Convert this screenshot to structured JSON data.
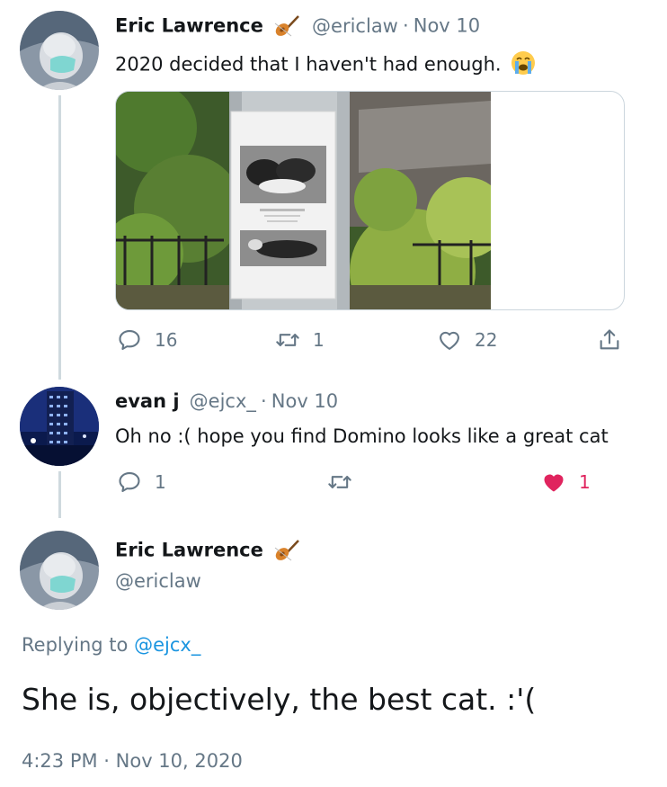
{
  "tweet1": {
    "name": "Eric Lawrence",
    "name_emoji": "violin-emoji",
    "handle": "@ericlaw",
    "sep": "·",
    "date": "Nov 10",
    "text": "2020 decided that I haven't had enough.",
    "text_emoji": "crying-face-emoji",
    "actions": {
      "reply": "16",
      "retweet": "1",
      "like": "22"
    }
  },
  "tweet2": {
    "name": "evan j",
    "handle": "@ejcx_",
    "sep": "·",
    "date": "Nov 10",
    "text": "Oh no :( hope you find Domino looks like a great cat",
    "actions": {
      "reply": "1",
      "retweet": "",
      "like": "1"
    }
  },
  "main_tweet": {
    "name": "Eric Lawrence",
    "name_emoji": "violin-emoji",
    "handle": "@ericlaw",
    "replying_prefix": "Replying to",
    "replying_handle": "@ejcx_",
    "text": "She is, objectively, the best cat. :'(",
    "timestamp": "4:23 PM · Nov 10, 2020"
  },
  "colors": {
    "link": "#1b95e0",
    "secondary": "#657786",
    "like_active": "#e0245e",
    "thread_line": "#cfd9de"
  }
}
